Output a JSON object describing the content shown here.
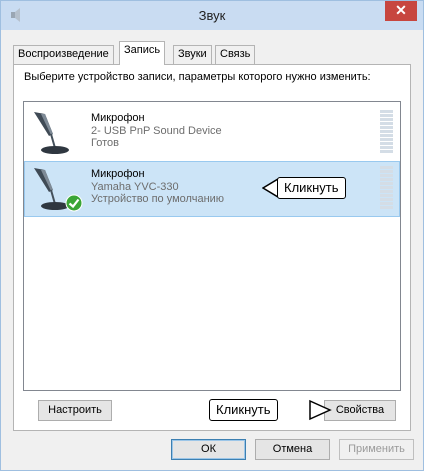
{
  "window": {
    "title": "Звук",
    "close_glyph": "✕"
  },
  "tabs": [
    {
      "label": "Воспроизведение"
    },
    {
      "label": "Запись"
    },
    {
      "label": "Звуки"
    },
    {
      "label": "Связь"
    }
  ],
  "instruction": "Выберите устройство записи, параметры которого нужно изменить:",
  "devices": [
    {
      "name": "Микрофон",
      "desc": "2- USB PnP Sound Device",
      "status": "Готов",
      "icon": "microphone-icon"
    },
    {
      "name": "Микрофон",
      "desc": "Yamaha YVC-330",
      "status": "Устройство по умолчанию",
      "icon": "microphone-icon",
      "badge": "default-check-icon"
    }
  ],
  "buttons": {
    "configure": "Настроить",
    "properties": "Свойства",
    "ok": "ОК",
    "cancel": "Отмена",
    "apply": "Применить"
  },
  "callouts": {
    "device": "Кликнуть",
    "properties": "Кликнуть"
  },
  "colors": {
    "titlebar": "#c9dcf2",
    "close": "#c7463f",
    "selection": "#cce4f7",
    "check": "#3aa536"
  }
}
